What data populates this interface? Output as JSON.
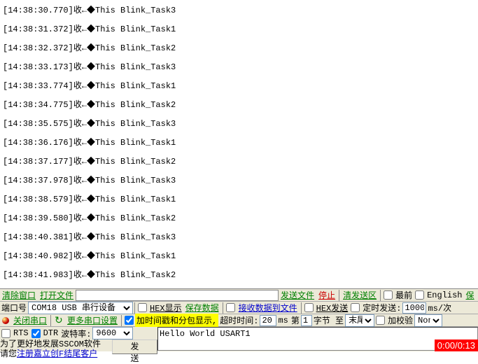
{
  "log": {
    "lines": [
      "[14:38:30.770]收←◆This Blink_Task3",
      "[14:38:31.372]收←◆This Blink_Task1",
      "[14:38:32.372]收←◆This Blink_Task2",
      "[14:38:33.173]收←◆This Blink_Task3",
      "[14:38:33.774]收←◆This Blink_Task1",
      "[14:38:34.775]收←◆This Blink_Task2",
      "[14:38:35.575]收←◆This Blink_Task3",
      "[14:38:36.176]收←◆This Blink_Task1",
      "[14:38:37.177]收←◆This Blink_Task2",
      "[14:38:37.978]收←◆This Blink_Task3",
      "[14:38:38.579]收←◆This Blink_Task1",
      "[14:38:39.580]收←◆This Blink_Task2",
      "[14:38:40.381]收←◆This Blink_Task3",
      "[14:38:40.982]收←◆This Blink_Task1",
      "[14:38:41.983]收←◆This Blink_Task2"
    ]
  },
  "row1": {
    "clear": "清除窗口",
    "open": "打开文件",
    "sendfile": "发送文件",
    "stop": "停止",
    "clearsend": "清发送区",
    "front": "最前",
    "english": "English",
    "save": "保"
  },
  "row2": {
    "portlbl": "端口号",
    "port": "COM18 USB 串行设备",
    "hexshow": "HEX显示",
    "savedata": "保存数据",
    "rxtofile": "接收数据到文件",
    "hexsend": "HEX发送",
    "timedsend": "定时发送:",
    "interval": "1000",
    "unit": "ms/次"
  },
  "row3": {
    "closeport": "关闭串口",
    "moresettings": "更多串口设置",
    "timestamp": "加时间戳和分包显示,",
    "timeoutlbl": "超时时间:",
    "timeout": "20",
    "ms": "ms",
    "no": "第",
    "noval": "1",
    "byte": "字节 至",
    "end": "末尾",
    "check": "加校验",
    "checkval": "None"
  },
  "row4": {
    "rts": "RTS",
    "dtr": "DTR",
    "baudlbl": "波特率:",
    "baud": "9600",
    "input": "Hello World USART1",
    "send": "发 送",
    "tip1": "为了更好地发展SSCOM软件",
    "tip2a": "请您",
    "tip2b": "注册嘉立创F结尾客户"
  },
  "status": "0:00/0:13"
}
